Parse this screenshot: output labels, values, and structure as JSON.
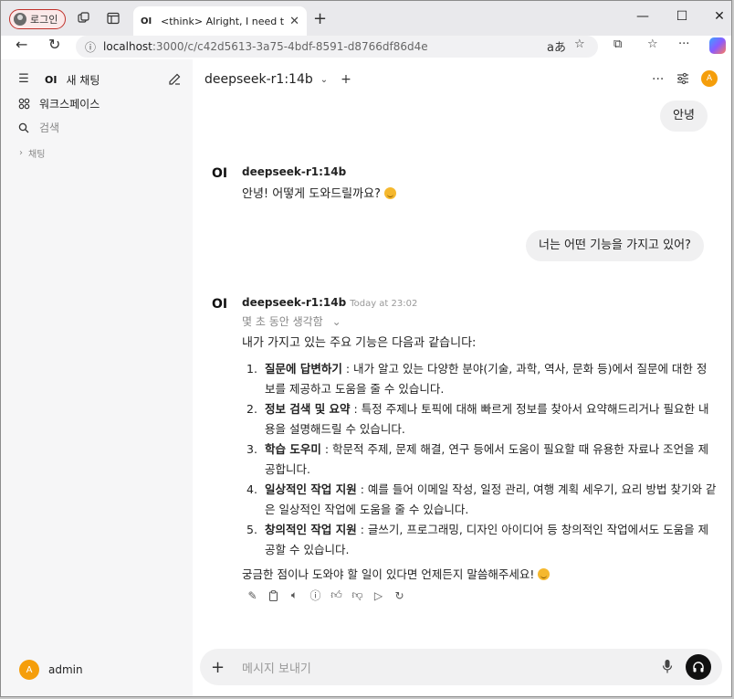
{
  "browser": {
    "profile_label": "로그인",
    "tab_favicon": "OI",
    "tab_title": "<think> Alright, I need to cre... |",
    "url_host": "localhost",
    "url_path": ":3000/c/c42d5613-3a75-4bdf-8591-d8766df86d4e"
  },
  "sidebar": {
    "logo": "OI",
    "new_chat": "새 채팅",
    "workspace": "워크스페이스",
    "search_placeholder": "검색",
    "chats_label": "채팅",
    "user_initial": "A",
    "user_name": "admin"
  },
  "header": {
    "model": "deepseek-r1:14b",
    "user_initial": "A"
  },
  "messages": {
    "user1": "안녕",
    "assistant1_name": "deepseek-r1:14b",
    "assistant1_text": "안녕! 어떻게 도와드릴까요?",
    "user2": "너는 어떤 기능을 가지고 있어?",
    "assistant2_name": "deepseek-r1:14b",
    "assistant2_time": "Today at 23:02",
    "thinking_label": "몇 초 동안 생각함",
    "intro": "내가 가지고 있는 주요 기능은 다음과 같습니다:",
    "items": [
      {
        "num": "1.",
        "title": "질문에 답변하기",
        "text": " : 내가 알고 있는 다양한 분야(기술, 과학, 역사, 문화 등)에서 질문에 대한 정보를 제공하고 도움을 줄 수 있습니다."
      },
      {
        "num": "2.",
        "title": "정보 검색 및 요약",
        "text": " : 특정 주제나 토픽에 대해 빠르게 정보를 찾아서 요약해드리거나 필요한 내용을 설명해드릴 수 있습니다."
      },
      {
        "num": "3.",
        "title": "학습 도우미",
        "text": " : 학문적 주제, 문제 해결, 연구 등에서 도움이 필요할 때 유용한 자료나 조언을 제공합니다."
      },
      {
        "num": "4.",
        "title": "일상적인 작업 지원",
        "text": " : 예를 들어 이메일 작성, 일정 관리, 여행 계획 세우기, 요리 방법 찾기와 같은 일상적인 작업에 도움을 줄 수 있습니다."
      },
      {
        "num": "5.",
        "title": "창의적인 작업 지원",
        "text": " : 글쓰기, 프로그래밍, 디자인 아이디어 등 창의적인 작업에서도 도움을 제공할 수 있습니다."
      }
    ],
    "outro": "궁금한 점이나 도와야 할 일이 있다면 언제든지 말씀해주세요!"
  },
  "composer": {
    "placeholder": "메시지 보내기"
  }
}
